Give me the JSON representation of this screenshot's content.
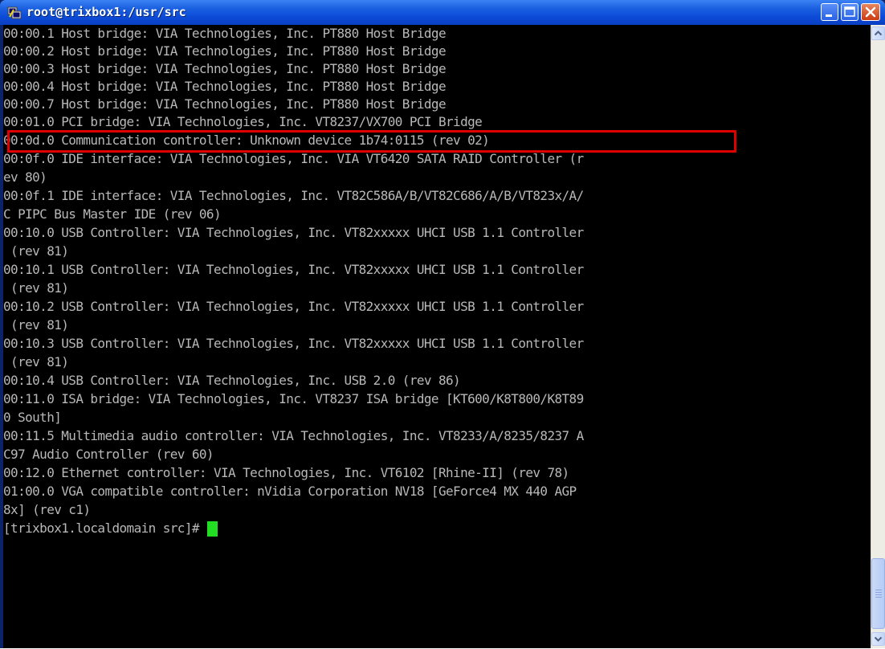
{
  "window": {
    "title": "root@trixbox1:/usr/src",
    "icon": "putty-icon",
    "buttons": {
      "minimize": "minimize-icon",
      "maximize": "maximize-icon",
      "close": "close-icon"
    }
  },
  "terminal": {
    "lines": [
      "00:00.1 Host bridge: VIA Technologies, Inc. PT880 Host Bridge",
      "00:00.2 Host bridge: VIA Technologies, Inc. PT880 Host Bridge",
      "00:00.3 Host bridge: VIA Technologies, Inc. PT880 Host Bridge",
      "00:00.4 Host bridge: VIA Technologies, Inc. PT880 Host Bridge",
      "00:00.7 Host bridge: VIA Technologies, Inc. PT880 Host Bridge",
      "00:01.0 PCI bridge: VIA Technologies, Inc. VT8237/VX700 PCI Bridge",
      "00:0d.0 Communication controller: Unknown device 1b74:0115 (rev 02)",
      "00:0f.0 IDE interface: VIA Technologies, Inc. VIA VT6420 SATA RAID Controller (r",
      "ev 80)",
      "00:0f.1 IDE interface: VIA Technologies, Inc. VT82C586A/B/VT82C686/A/B/VT823x/A/",
      "C PIPC Bus Master IDE (rev 06)",
      "00:10.0 USB Controller: VIA Technologies, Inc. VT82xxxxx UHCI USB 1.1 Controller",
      " (rev 81)",
      "00:10.1 USB Controller: VIA Technologies, Inc. VT82xxxxx UHCI USB 1.1 Controller",
      " (rev 81)",
      "00:10.2 USB Controller: VIA Technologies, Inc. VT82xxxxx UHCI USB 1.1 Controller",
      " (rev 81)",
      "00:10.3 USB Controller: VIA Technologies, Inc. VT82xxxxx UHCI USB 1.1 Controller",
      " (rev 81)",
      "00:10.4 USB Controller: VIA Technologies, Inc. USB 2.0 (rev 86)",
      "00:11.0 ISA bridge: VIA Technologies, Inc. VT8237 ISA bridge [KT600/K8T800/K8T89",
      "0 South]",
      "00:11.5 Multimedia audio controller: VIA Technologies, Inc. VT8233/A/8235/8237 A",
      "C97 Audio Controller (rev 60)",
      "00:12.0 Ethernet controller: VIA Technologies, Inc. VT6102 [Rhine-II] (rev 78)",
      "01:00.0 VGA compatible controller: nVidia Corporation NV18 [GeForce4 MX 440 AGP",
      "8x] (rev c1)"
    ],
    "prompt": "[trixbox1.localdomain src]#",
    "highlight_color": "#e00000",
    "cursor_color": "#22dd22",
    "text_color": "#b8b8b8",
    "background": "#000000"
  },
  "scrollbar": {
    "up_icon": "scroll-up-arrow-icon",
    "down_icon": "scroll-down-arrow-icon"
  }
}
